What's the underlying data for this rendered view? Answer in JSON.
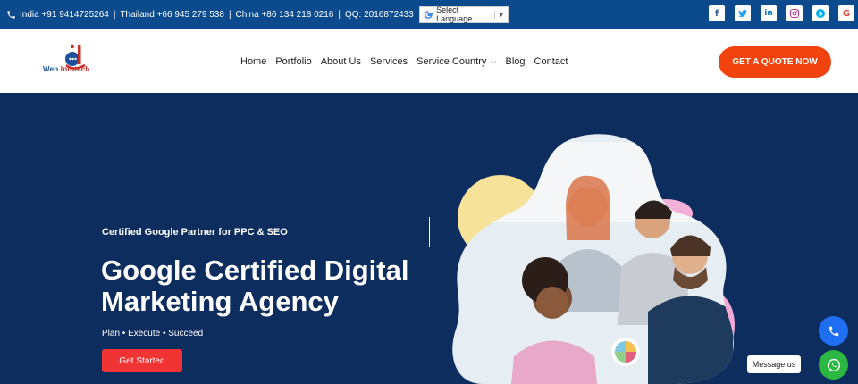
{
  "topbar": {
    "contacts": [
      {
        "text": "India +91 9414725264"
      },
      {
        "text": "Thailand +66 945 279 538"
      },
      {
        "text": "China +86 134 218 0216"
      },
      {
        "text": "QQ: 2016872433"
      }
    ],
    "separator": "|",
    "language_label": "Select Language",
    "language_arrow": "▼",
    "socials": [
      {
        "icon": "facebook-icon",
        "glyph": "f",
        "color": "#3b5998"
      },
      {
        "icon": "twitter-icon",
        "glyph": "t",
        "color": "#1da1f2"
      },
      {
        "icon": "linkedin-icon",
        "glyph": "in",
        "color": "#0077b5"
      },
      {
        "icon": "instagram-icon",
        "glyph": "◎",
        "color": "#c13584"
      },
      {
        "icon": "skype-icon",
        "glyph": "S",
        "color": "#00aff0"
      },
      {
        "icon": "google-icon",
        "glyph": "G",
        "color": "#db4437"
      }
    ]
  },
  "header": {
    "logo_text_a": "Web ",
    "logo_text_b": "Infotech",
    "nav": [
      "Home",
      "Portfolio",
      "About Us",
      "Services",
      "Service Country",
      "Blog",
      "Contact"
    ],
    "cta_label": "GET A QUOTE NOW"
  },
  "hero": {
    "eyebrow": "Certified Google Partner for PPC & SEO",
    "headline": "Google Certified Digital Marketing Agency",
    "tagline": "Plan • Execute • Succeed",
    "button_label": "Get Started"
  },
  "chat": {
    "message_label": "Message us"
  },
  "colors": {
    "topbar": "#0b4a8c",
    "hero": "#0c2d5e",
    "cta": "#f2430f",
    "start": "#f03434",
    "call": "#1e6ff2",
    "whatsapp": "#2bb741"
  }
}
